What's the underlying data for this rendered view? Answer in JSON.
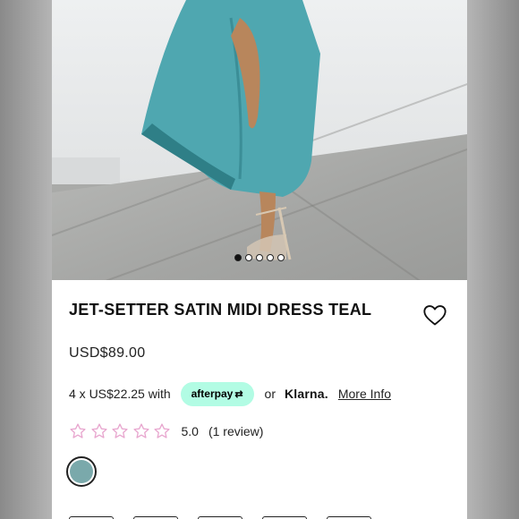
{
  "product": {
    "title": "JET-SETTER SATIN MIDI DRESS TEAL",
    "price": "USD$89.00"
  },
  "gallery": {
    "slide_count": 5,
    "active_index": 0
  },
  "payment": {
    "installment_text": "4 x US$22.25 with",
    "afterpay_label": "afterpay",
    "or_text": "or",
    "klarna_label": "Klarna.",
    "more_info_label": "More Info",
    "afterpay_color": "#b2fce4"
  },
  "rating": {
    "score": "5.0",
    "reviews": "(1 review)",
    "stars_total": 5,
    "star_color": "#e8a7cf"
  },
  "swatch": {
    "color": "#7aa9ab"
  },
  "icons": {
    "wishlist": "heart-outline-icon",
    "star": "star-outline-icon"
  }
}
